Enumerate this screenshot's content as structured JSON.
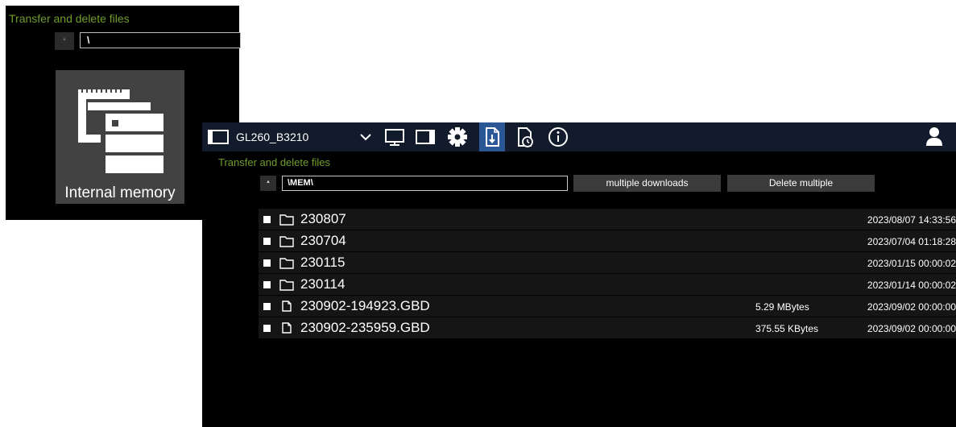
{
  "back_window": {
    "title": "Transfer and delete files",
    "path_value": "\\",
    "tiles": [
      {
        "label": "Internal memory",
        "icon": "internal-memory-icon"
      }
    ]
  },
  "front_window": {
    "device_name": "GL260_B3210",
    "toolbar_icons": [
      "device-icon",
      "chevron-down-icon",
      "monitor-icon",
      "sd-card-icon",
      "gear-icon",
      "file-download-icon",
      "file-history-icon",
      "info-icon",
      "user-icon"
    ],
    "active_toolbar_icon": "file-download-icon",
    "section_title": "Transfer and delete files",
    "path_value": "\\MEM\\",
    "buttons": {
      "multiple_downloads": "multiple downloads",
      "delete_multiple": "Delete multiple"
    },
    "files": [
      {
        "type": "folder",
        "name": "230807",
        "size": "",
        "date": "2023/08/07 14:33:56"
      },
      {
        "type": "folder",
        "name": "230704",
        "size": "",
        "date": "2023/07/04 01:18:28"
      },
      {
        "type": "folder",
        "name": "230115",
        "size": "",
        "date": "2023/01/15 00:00:02"
      },
      {
        "type": "folder",
        "name": "230114",
        "size": "",
        "date": "2023/01/14 00:00:02"
      },
      {
        "type": "file",
        "name": "230902-194923.GBD",
        "size": "5.29 MBytes",
        "date": "2023/09/02 00:00:00"
      },
      {
        "type": "file",
        "name": "230902-235959.GBD",
        "size": "375.55 KBytes",
        "date": "2023/09/02 00:00:00"
      }
    ]
  },
  "colors": {
    "accent_green": "#6f9d2c",
    "toolbar_bg": "#111b2b",
    "active_tab": "#2c5796"
  }
}
